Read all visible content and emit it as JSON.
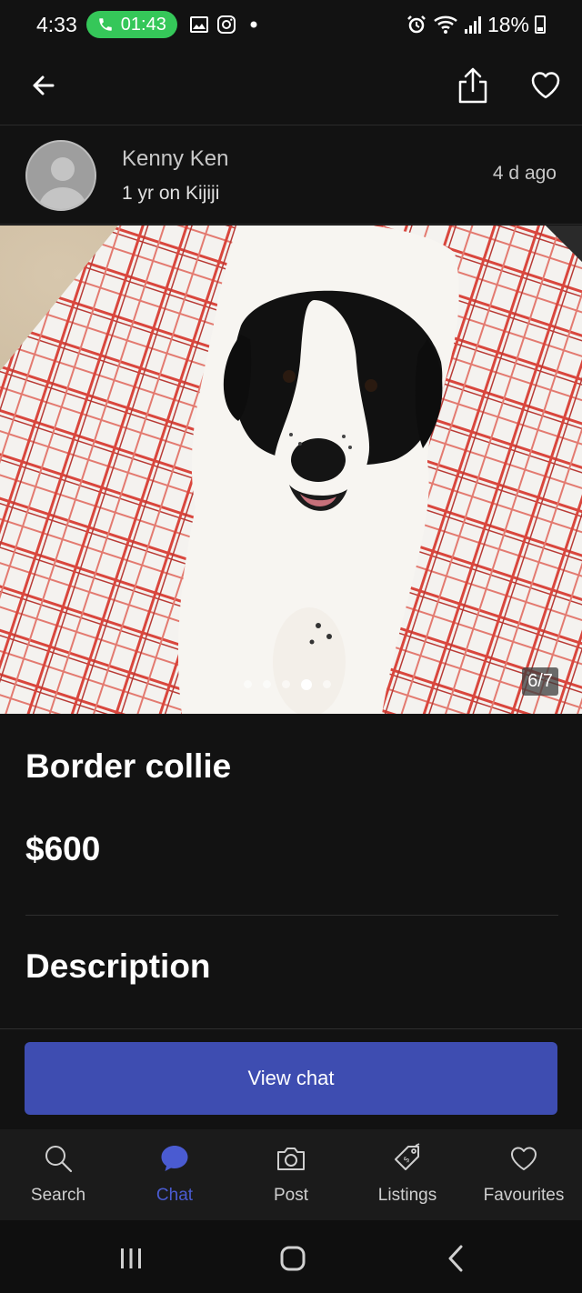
{
  "status_bar": {
    "time": "4:33",
    "call_timer": "01:43",
    "battery": "18%",
    "icons": [
      "phone-icon",
      "image-icon",
      "instagram-icon",
      "dot-icon",
      "alarm-icon",
      "wifi-icon",
      "signal-icon",
      "battery-icon"
    ]
  },
  "app_bar": {
    "icons": [
      "back-arrow-icon",
      "share-icon",
      "heart-icon"
    ]
  },
  "seller": {
    "name": "Kenny Ken",
    "meta": "1 yr on Kijiji",
    "posted": "4 d  ago"
  },
  "photo": {
    "counter": "6/7",
    "current": 6,
    "total": 7
  },
  "listing": {
    "title": "Border collie",
    "price": "$600",
    "description_heading": "Description"
  },
  "actions": {
    "view_chat": "View chat"
  },
  "bottom_nav": {
    "items": [
      {
        "label": "Search",
        "icon": "search-icon"
      },
      {
        "label": "Chat",
        "icon": "chat-bubble-icon",
        "active": true
      },
      {
        "label": "Post",
        "icon": "camera-icon"
      },
      {
        "label": "Listings",
        "icon": "price-tag-icon"
      },
      {
        "label": "Favourites",
        "icon": "heart-icon"
      }
    ]
  },
  "colors": {
    "background": "#121212",
    "accent": "#3e4db1",
    "active_nav": "#4a5bd1",
    "call_pill": "#35c759"
  }
}
